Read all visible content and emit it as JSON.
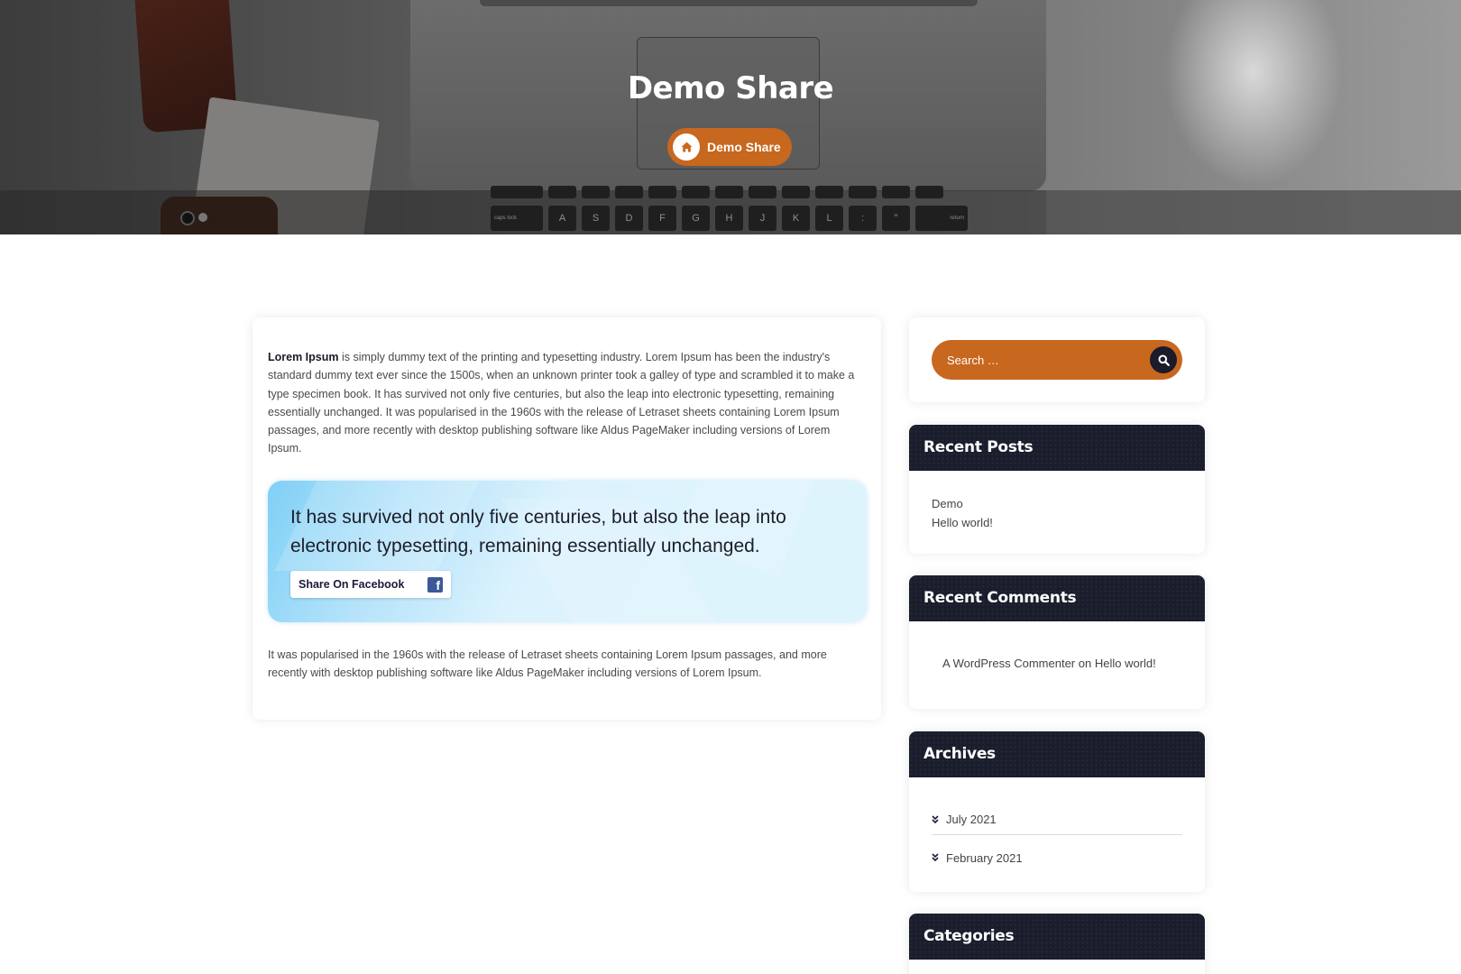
{
  "hero": {
    "title": "Demo Share",
    "breadcrumb_label": "Demo Share",
    "keyboard_keys_row2": [
      "A",
      "S",
      "D",
      "F",
      "G",
      "H",
      "J",
      "K",
      "L",
      ":",
      "\""
    ],
    "keyboard_caps_label": "caps lock",
    "keyboard_return_label": "return"
  },
  "post": {
    "intro_bold": "Lorem Ipsum",
    "intro_rest": " is simply dummy text of the printing and typesetting industry. Lorem Ipsum has been the industry's standard dummy text ever since the 1500s, when an unknown printer took a galley of type and scrambled it to make a type specimen book. It has survived not only five centuries, but also the leap into electronic typesetting, remaining essentially unchanged. It was popularised in the 1960s with the release of Letraset sheets containing Lorem Ipsum passages, and more recently with desktop publishing software like Aldus PageMaker including versions of Lorem Ipsum.",
    "quote": "It has survived not only five centuries, but also the leap into electronic typesetting, remaining essentially unchanged.",
    "share_label": "Share On Facebook",
    "outro": "It was popularised in the 1960s with the release of Letraset sheets containing Lorem Ipsum passages, and more recently with desktop publishing software like Aldus PageMaker including versions of Lorem Ipsum."
  },
  "sidebar": {
    "search": {
      "placeholder": "Search …"
    },
    "recent_posts": {
      "title": "Recent Posts",
      "items": [
        "Demo",
        "Hello world!"
      ]
    },
    "recent_comments": {
      "title": "Recent Comments",
      "author": "A WordPress Commenter",
      "connector": " on ",
      "post": "Hello world!"
    },
    "archives": {
      "title": "Archives",
      "items": [
        "July 2021",
        "February 2021"
      ]
    },
    "categories": {
      "title": "Categories"
    }
  },
  "colors": {
    "accent": "#c8671e",
    "widget_header": "#1a1d2b",
    "facebook": "#3b5998"
  },
  "icons": [
    "home-icon",
    "search-icon",
    "facebook-icon",
    "chevron-double-down-icon"
  ]
}
